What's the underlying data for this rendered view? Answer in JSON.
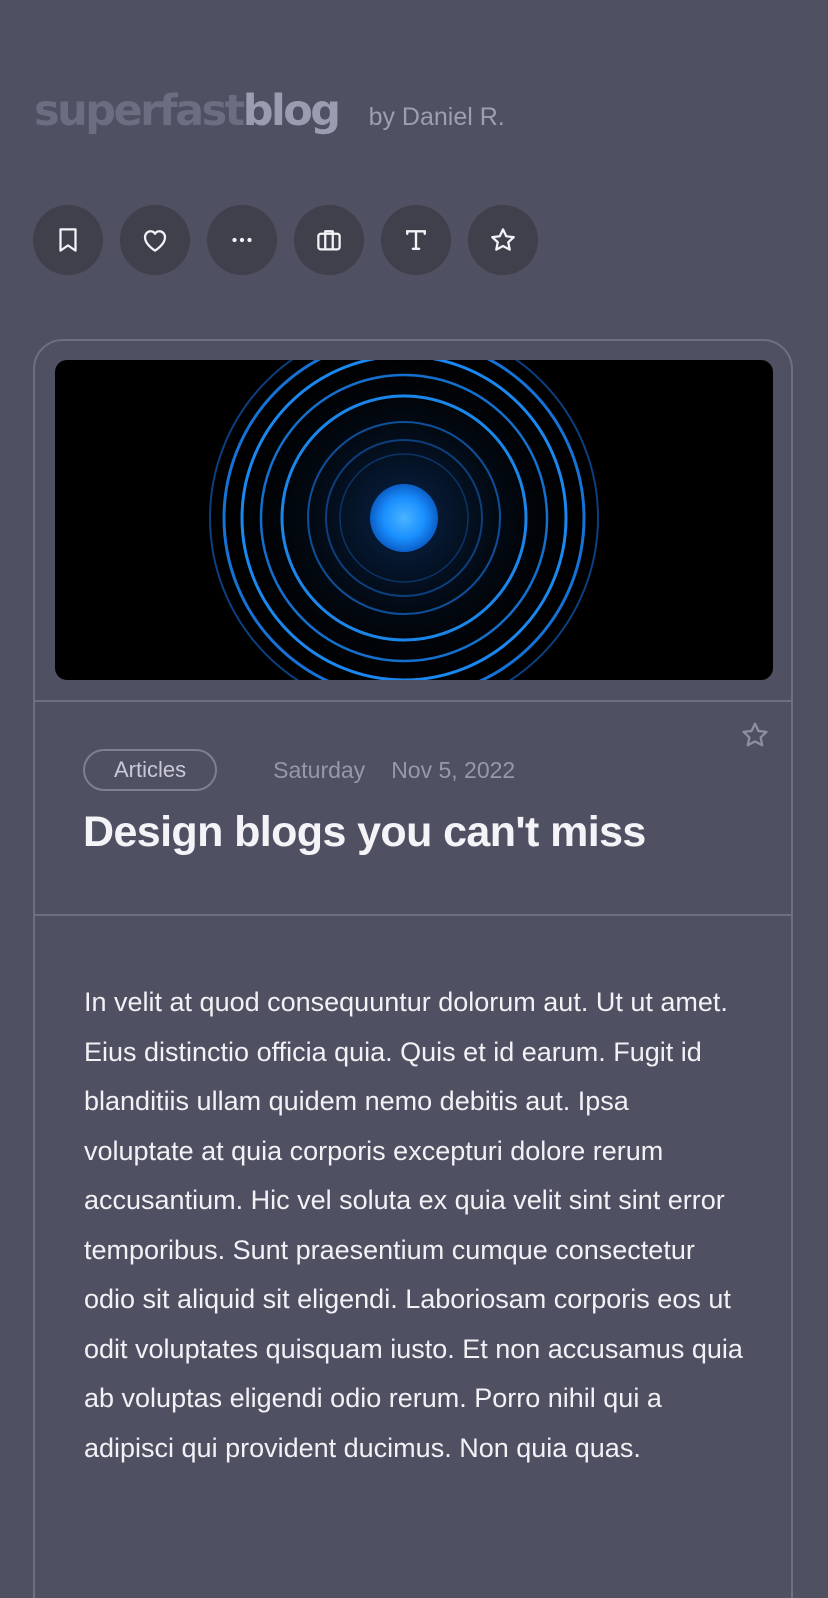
{
  "header": {
    "logo_part1": "superfast",
    "logo_part2": "blog",
    "byline": "by Daniel R."
  },
  "toolbar": {
    "buttons": [
      {
        "icon": "bookmark-icon"
      },
      {
        "icon": "heart-icon"
      },
      {
        "icon": "more-dots-icon"
      },
      {
        "icon": "briefcase-icon"
      },
      {
        "icon": "text-format-icon"
      },
      {
        "icon": "star-icon"
      }
    ]
  },
  "post": {
    "category": "Articles",
    "day": "Saturday",
    "date": "Nov 5, 2022",
    "title": "Design blogs you can't miss",
    "body": "In velit at quod consequuntur dolorum aut. Ut ut amet. Eius distinctio officia quia. Quis et id earum. Fugit id blanditiis ullam quidem nemo debitis aut. Ipsa voluptate at quia corporis excepturi dolore rerum accusantium. Hic vel soluta ex quia velit sint sint error temporibus. Sunt praesentium cumque consectetur odio sit aliquid sit eligendi. Laboriosam corporis eos ut odit voluptates quisquam iusto. Et non accusamus quia ab voluptas eligendi odio rerum. Porro nihil qui a adipisci qui provident ducimus. Non quia quas.",
    "favorite_icon": "star-outline-icon"
  },
  "colors": {
    "background": "#4f5061",
    "button_bg": "#3f404c",
    "accent_glow": "#1a8fff",
    "title_text": "#f3f3f8"
  }
}
